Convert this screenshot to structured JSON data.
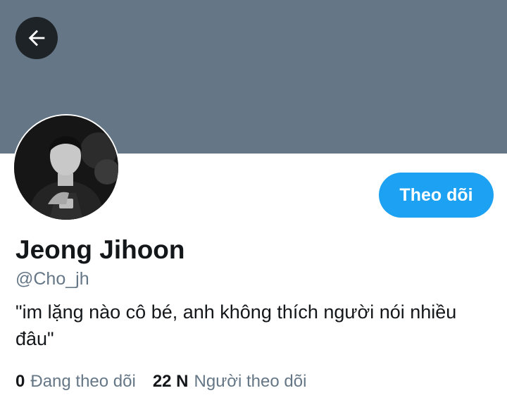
{
  "header": {
    "back_icon": "arrow-left-icon",
    "banner_color": "#657786"
  },
  "profile": {
    "display_name": "Jeong Jihoon",
    "handle": "@Cho_jh",
    "bio": "\"im lặng nào cô bé, anh không thích người nói nhiều đâu\"",
    "avatar_icon": "profile-photo"
  },
  "actions": {
    "follow_label": "Theo dõi",
    "accent_color": "#1da1f2"
  },
  "stats": {
    "following_count": "0",
    "following_label": "Đang theo dõi",
    "followers_count": "22 N",
    "followers_label": "Người theo dõi"
  }
}
